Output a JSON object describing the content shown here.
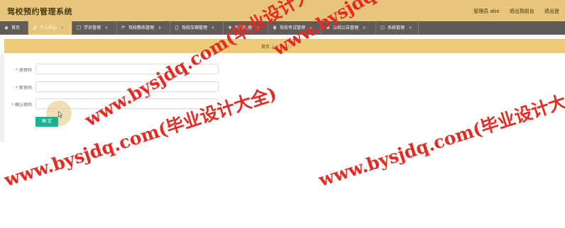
{
  "app": {
    "title": "驾校预约管理系统",
    "header_links": [
      "管理员 abo",
      "退出到前台",
      "退出登"
    ]
  },
  "nav": {
    "items": [
      {
        "label": "首页",
        "icon": "home-icon",
        "active": false
      },
      {
        "label": "个人中心",
        "icon": "user-icon",
        "active": true
      },
      {
        "label": "学员管理",
        "icon": "users-icon",
        "active": false
      },
      {
        "label": "驾校教练管理",
        "icon": "flag-icon",
        "active": false
      },
      {
        "label": "驾校车辆管理",
        "icon": "car-icon",
        "active": false
      },
      {
        "label": "预约管理",
        "icon": "location-icon",
        "active": false
      },
      {
        "label": "驾校考试管理",
        "icon": "document-icon",
        "active": false
      },
      {
        "label": "驾校公告管理",
        "icon": "bell-icon",
        "active": false
      },
      {
        "label": "系统管理",
        "icon": "settings-icon",
        "active": false
      }
    ]
  },
  "breadcrumb": {
    "home": "首页",
    "separator": "/",
    "current": "修改密码"
  },
  "form": {
    "fields": [
      {
        "label": "原密码",
        "required_mark": "*",
        "value": ""
      },
      {
        "label": "新密码",
        "required_mark": "*",
        "value": ""
      },
      {
        "label": "确认密码",
        "required_mark": "*",
        "value": ""
      }
    ],
    "submit_label": "确 定"
  },
  "watermark": {
    "line1": "www.bysjdq.com(毕业设计大全)",
    "line2": "www.bysjdq.com(毕业设计大全)"
  },
  "colors": {
    "header": "#e7c67b",
    "nav": "#5f5c59",
    "accent": "#19b394",
    "watermark": "#e52b23"
  }
}
